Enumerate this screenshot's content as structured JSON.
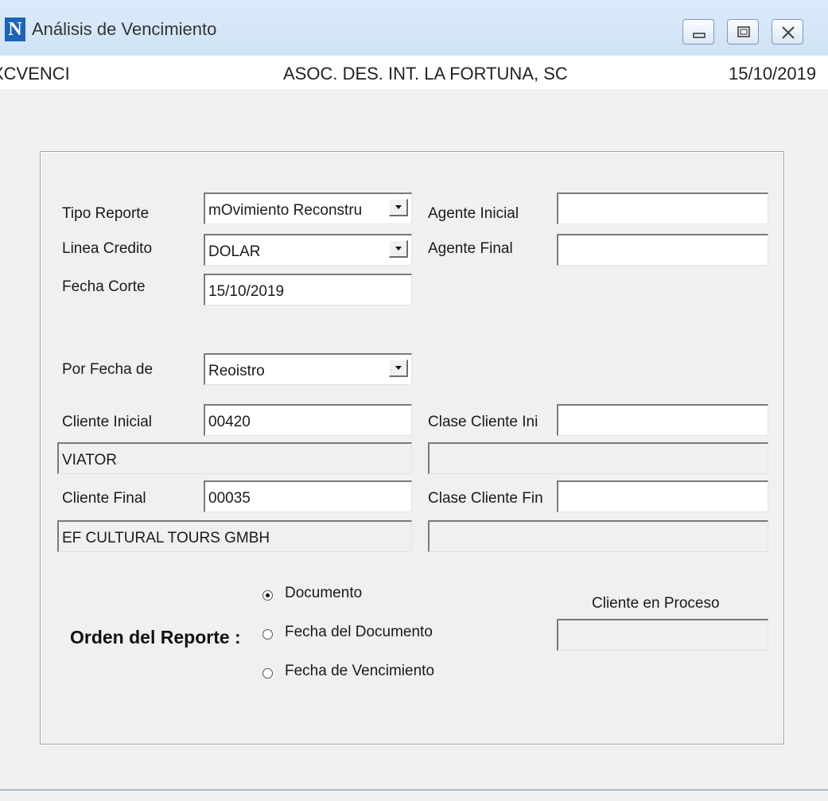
{
  "window": {
    "app_icon_glyph": "N",
    "title": "Análisis de Vencimiento",
    "controls": [
      "minimize-icon",
      "maximize-icon",
      "close-icon"
    ]
  },
  "header": {
    "program": "XCVENCI",
    "company": "ASOC. DES. INT. LA FORTUNA, SC",
    "date": "15/10/2019"
  },
  "form": {
    "tipo_reporte": {
      "label": "Tipo Reporte",
      "value": "mOvimiento Reconstru"
    },
    "linea_credito": {
      "label": "Linea Credito",
      "value": "DOLAR"
    },
    "fecha_corte": {
      "label": "Fecha Corte",
      "value": "15/10/2019"
    },
    "agente_inicial": {
      "label": "Agente Inicial",
      "value": ""
    },
    "agente_final": {
      "label": "Agente Final",
      "value": ""
    },
    "por_fecha_de": {
      "label": "Por Fecha de",
      "value": "Reoistro"
    },
    "cliente_inicial": {
      "label": "Cliente Inicial",
      "value": "00420",
      "name": "VIATOR"
    },
    "clase_cliente_ini": {
      "label": "Clase Cliente Ini",
      "value": "",
      "desc": ""
    },
    "cliente_final": {
      "label": "Cliente Final",
      "value": "00035",
      "name": "EF CULTURAL TOURS GMBH"
    },
    "clase_cliente_fin": {
      "label": "Clase Cliente Fin",
      "value": "",
      "desc": ""
    }
  },
  "orden": {
    "label": "Orden del Reporte :",
    "options": [
      "Documento",
      "Fecha del Documento",
      "Fecha de Vencimiento"
    ],
    "selected": "Documento"
  },
  "proceso": {
    "label": "Cliente en Proceso",
    "value": ""
  },
  "colors": {
    "titlebar": "#cfe2f6",
    "dialog_bg": "#f0f0f0",
    "field_bg": "#ffffff",
    "app_icon": "#1f63b8"
  }
}
